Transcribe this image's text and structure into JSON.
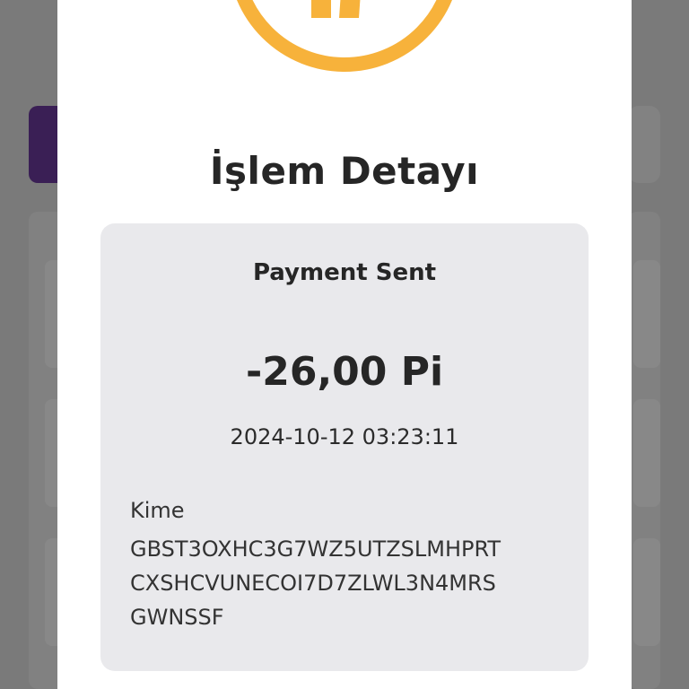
{
  "colors": {
    "overlay": "#7a7a7a",
    "accent_purple": "#3a1f55",
    "icon_orange": "#f7b23b",
    "card_bg": "#e9e9ec",
    "text_dark": "#262626"
  },
  "modal": {
    "status_icon": "pi-logo-icon",
    "title": "İşlem Detayı",
    "transaction": {
      "type": "Payment Sent",
      "amount": "-26,00 Pi",
      "datetime": "2024-10-12 03:23:11",
      "recipient_label": "Kime",
      "recipient_address_lines": [
        "GBST3OXHC3G7WZ5UTZSLMHPRT",
        "CXSHCVUNECOI7D7ZLWL3N4MRS",
        "GWNSSF"
      ]
    }
  }
}
